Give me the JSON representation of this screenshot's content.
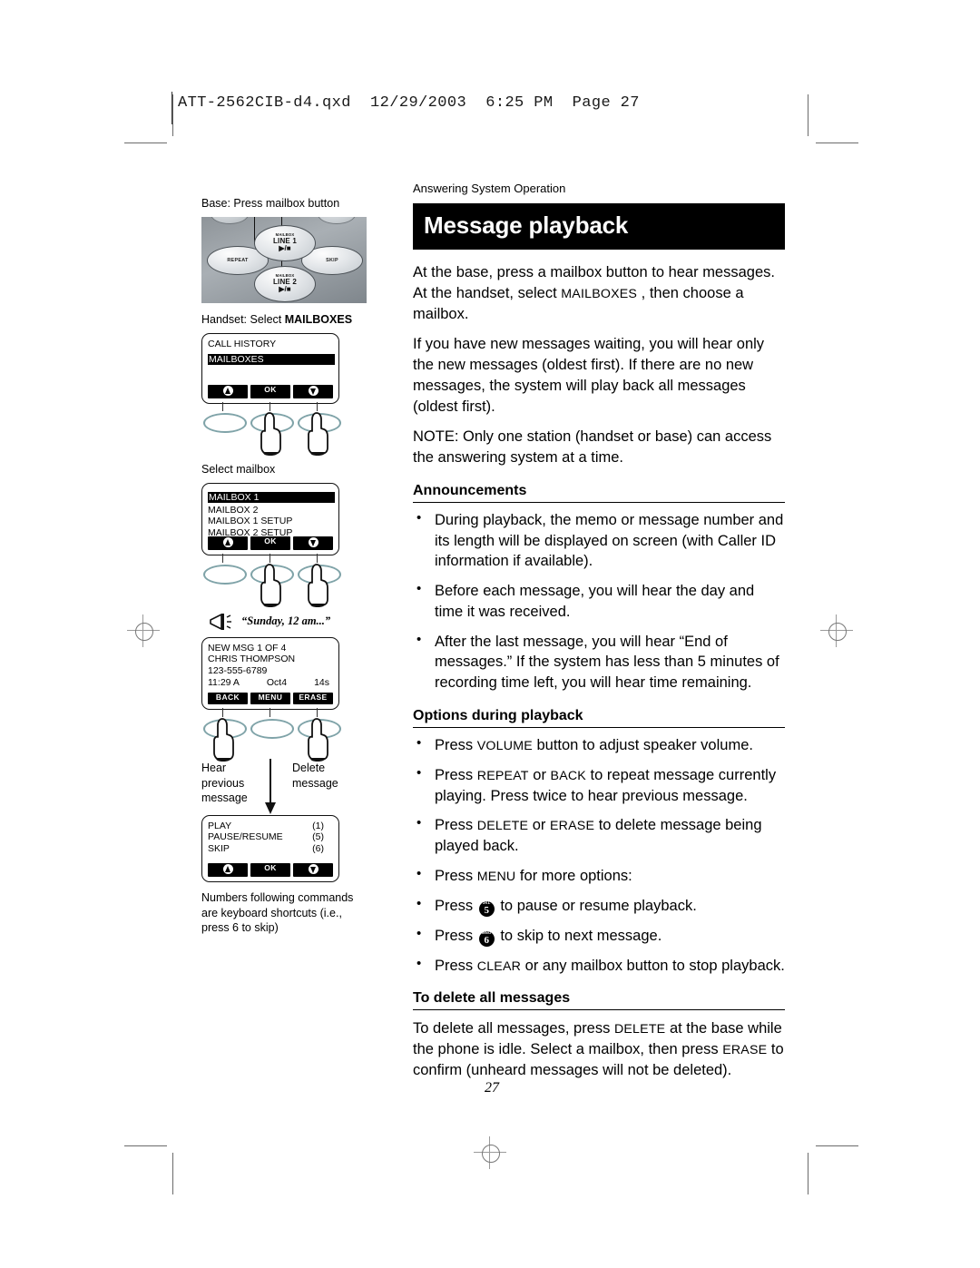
{
  "film_header": "ATT-2562CIB-d4.qxd  12/29/2003  6:25 PM  Page 27",
  "folio": "27",
  "right": {
    "kicker": "Answering System Operation",
    "title": "Message playback",
    "intro_1_a": "At the base, press a mailbox button to hear messages.",
    "intro_1_b_pre": "At the handset, select ",
    "intro_1_b_sc": "MAILBOXES",
    "intro_1_b_post": " , then choose a mailbox.",
    "intro_2": "If you have new messages waiting, you will hear only the new messages (oldest first). If there are no new messages, the system will play back all messages (oldest first).",
    "intro_3": "NOTE: Only one station (handset or base) can access the answering system at a time.",
    "sections": [
      {
        "heading": "Announcements",
        "bullets": [
          "During playback, the memo or message number and its length will be displayed on screen (with Caller ID information if available).",
          "Before each message, you will hear the day and time it was received.",
          "After the last message, you will hear “End of messages.” If the system has less than 5 minutes of recording time left, you will hear time remaining."
        ]
      },
      {
        "heading": "Options during playback",
        "bullets": [
          {
            "pre": "Press ",
            "sc": "VOLUME",
            "post": " button to adjust speaker volume."
          },
          {
            "pre": "Press ",
            "sc": "REPEAT",
            "mid": " or ",
            "sc2": "BACK",
            "post": " to repeat message currently playing. Press twice to hear previous message."
          },
          {
            "pre": "Press ",
            "sc": "DELETE",
            "mid": " or ",
            "sc2": "ERASE",
            "post": " to delete message being played back."
          },
          {
            "pre": "Press ",
            "sc": "MENU",
            "post": " for more options:"
          },
          {
            "pre": "Press ",
            "key": "5",
            "key_sub": "JKL",
            "post": " to pause or resume playback."
          },
          {
            "pre": "Press ",
            "key": "6",
            "key_sub": "MNO",
            "post": " to skip to next message."
          },
          {
            "pre": "Press ",
            "sc": "CLEAR",
            "post": " or any mailbox button to stop playback."
          }
        ]
      },
      {
        "heading": "To delete all messages",
        "body_pre": "To delete all messages, press ",
        "body_sc1": "DELETE",
        "body_mid": " at the base while the phone is idle. Select a mailbox, then press ",
        "body_sc2": "ERASE",
        "body_post": " to confirm (unheard messages will not be deleted)."
      }
    ]
  },
  "left": {
    "base_caption": "Base: Press mailbox button",
    "base_buttons": {
      "mailbox_label": "MAILBOX",
      "line1": "LINE 1",
      "line2": "LINE 2",
      "play_stop": "▶/■",
      "repeat": "REPEAT",
      "skip": "SKIP"
    },
    "handset_caption_pre": "Handset: Select ",
    "handset_caption_bold": "MAILBOXES",
    "screen1": {
      "lines": [
        "CALL HISTORY",
        "MAILBOXES"
      ],
      "highlighted_index": 1,
      "softkeys": [
        "▲",
        "OK",
        "▼"
      ],
      "softkey_ok": "OK"
    },
    "select_mailbox_caption": "Select mailbox",
    "screen2": {
      "lines": [
        "MAILBOX 1",
        "MAILBOX 2",
        "MAILBOX 1 SETUP",
        "MAILBOX 2 SETUP"
      ],
      "highlighted_index": 0,
      "softkey_ok": "OK"
    },
    "voice_prompt": "“Sunday, 12 am...”",
    "screen3": {
      "line1": "NEW MSG 1 OF 4",
      "line2": "CHRIS THOMPSON",
      "line3": "123-555-6789",
      "time": "11:29 A",
      "date": "Oct4",
      "duration": "14s",
      "softkeys": [
        "BACK",
        "MENU",
        "ERASE"
      ]
    },
    "hand_labels": {
      "left": "Hear previous message",
      "right": "Delete message"
    },
    "screen4": {
      "rows": [
        {
          "label": "PLAY",
          "value": "(1)"
        },
        {
          "label": "PAUSE/RESUME",
          "value": "(5)"
        },
        {
          "label": "SKIP",
          "value": "(6)"
        }
      ],
      "softkey_ok": "OK"
    },
    "footnote": "Numbers following commands are keyboard shortcuts (i.e., press 6 to skip)"
  }
}
